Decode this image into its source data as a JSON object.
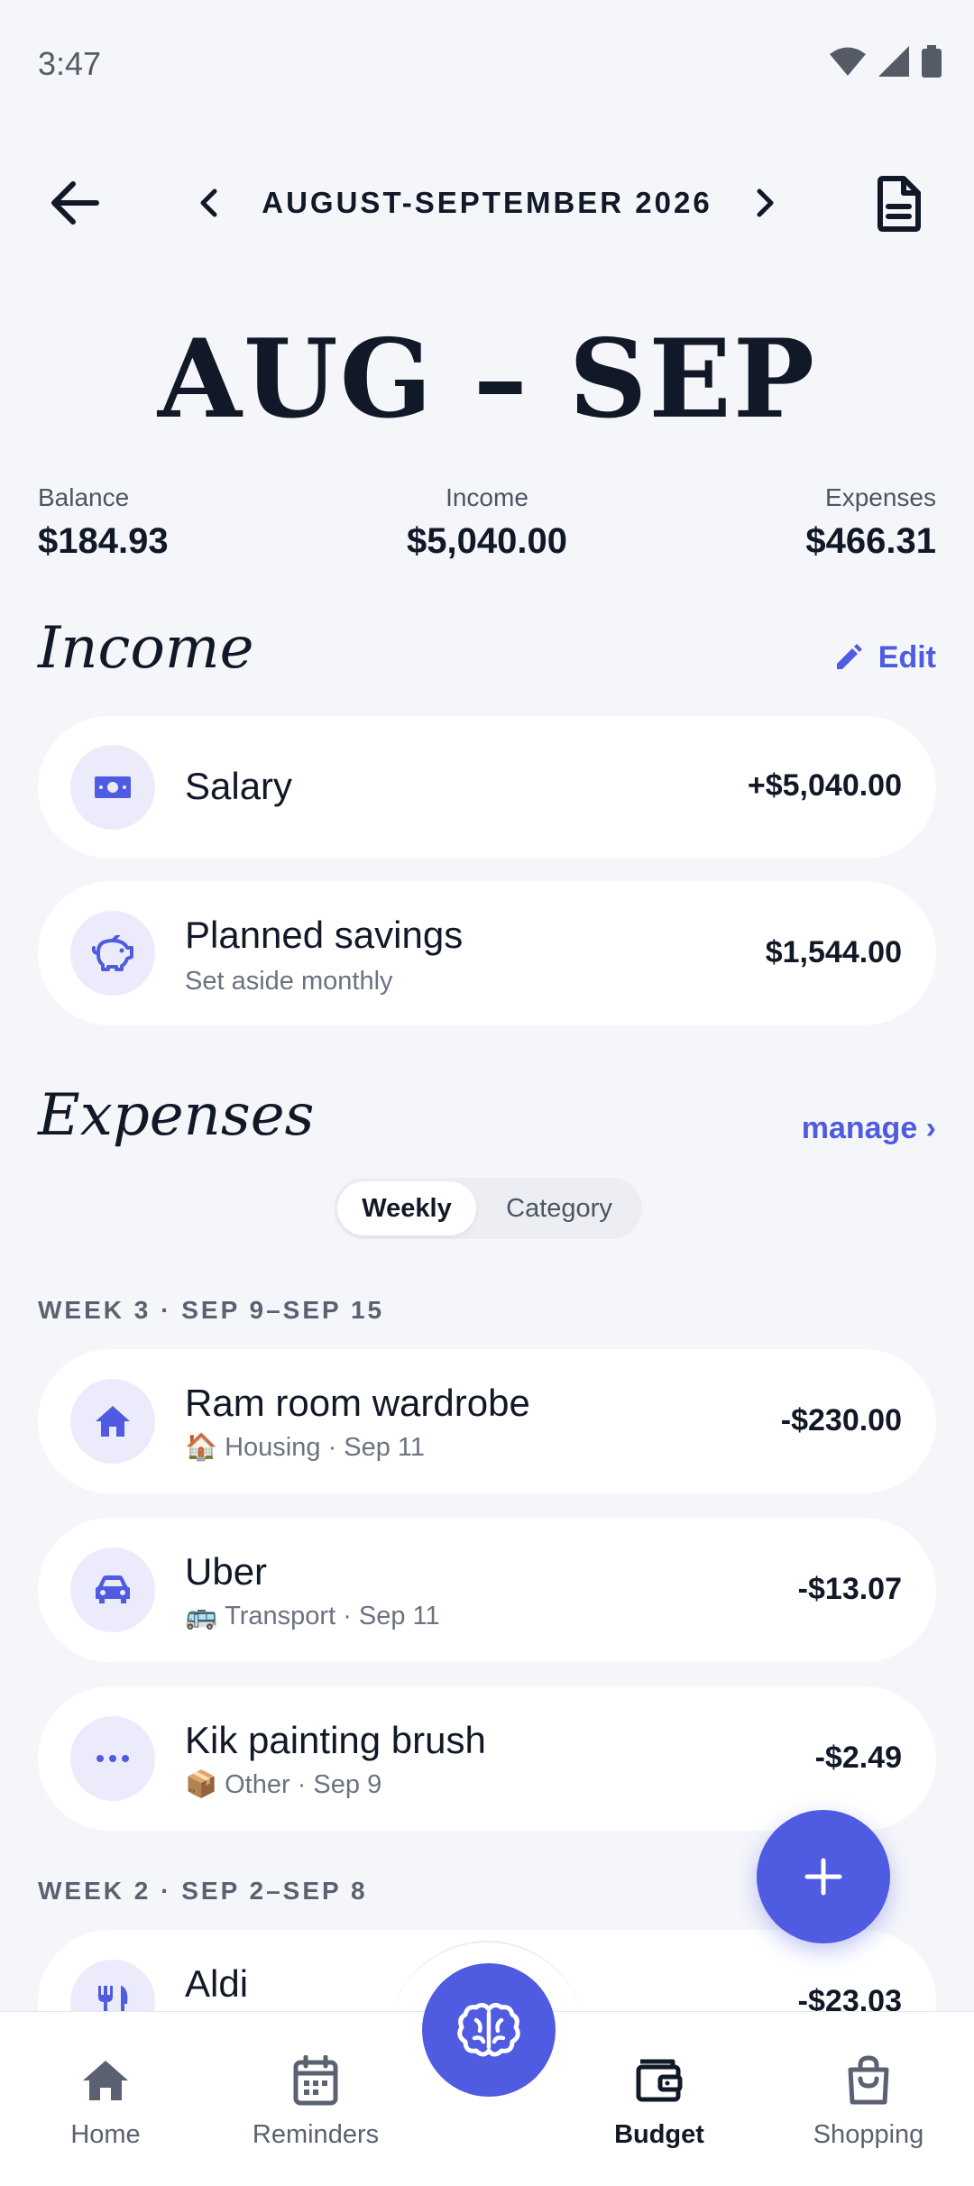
{
  "status": {
    "time": "3:47"
  },
  "nav": {
    "period_label": "AUGUST-SEPTEMBER 2026"
  },
  "hero": {
    "title": "AUG – SEP"
  },
  "summary": {
    "balance_label": "Balance",
    "balance_value": "$184.93",
    "income_label": "Income",
    "income_value": "$5,040.00",
    "expenses_label": "Expenses",
    "expenses_value": "$466.31"
  },
  "income": {
    "title": "Income",
    "edit_label": "Edit",
    "items": [
      {
        "title": "Salary",
        "subtitle": "",
        "amount": "+$5,040.00",
        "icon": "banknote-icon"
      },
      {
        "title": "Planned savings",
        "subtitle": "Set aside monthly",
        "amount": "$1,544.00",
        "icon": "piggy-bank-icon"
      }
    ]
  },
  "expenses": {
    "title": "Expenses",
    "manage_label": "manage ›",
    "tabs": {
      "weekly": "Weekly",
      "category": "Category",
      "selected": "Weekly"
    },
    "weeks": [
      {
        "header": "WEEK 3 · SEP 9–SEP 15",
        "items": [
          {
            "title": "Ram room wardrobe",
            "emoji": "🏠",
            "meta": "Housing · Sep 11",
            "amount": "-$230.00",
            "icon": "home-icon"
          },
          {
            "title": "Uber",
            "emoji": "🚌",
            "meta": "Transport · Sep 11",
            "amount": "-$13.07",
            "icon": "car-icon"
          },
          {
            "title": "Kik painting brush",
            "emoji": "📦",
            "meta": "Other · Sep 9",
            "amount": "-$2.49",
            "icon": "more-icon"
          }
        ]
      },
      {
        "header": "WEEK 2 · SEP 2–SEP 8",
        "items": [
          {
            "title": "Aldi",
            "emoji": "",
            "meta": "",
            "amount": "-$23.03",
            "icon": "fork-knife-icon"
          }
        ]
      }
    ]
  },
  "bottom_nav": {
    "items": [
      {
        "label": "Home",
        "icon": "home-icon"
      },
      {
        "label": "Reminders",
        "icon": "calendar-icon"
      },
      {
        "label": "Budget",
        "icon": "wallet-icon",
        "active": true
      },
      {
        "label": "Shopping",
        "icon": "shopping-bag-icon"
      }
    ],
    "center_icon": "brain-icon"
  },
  "colors": {
    "accent": "#4F5BE0",
    "background": "#F5F6FA",
    "icon_bg": "#ECEBFB"
  }
}
